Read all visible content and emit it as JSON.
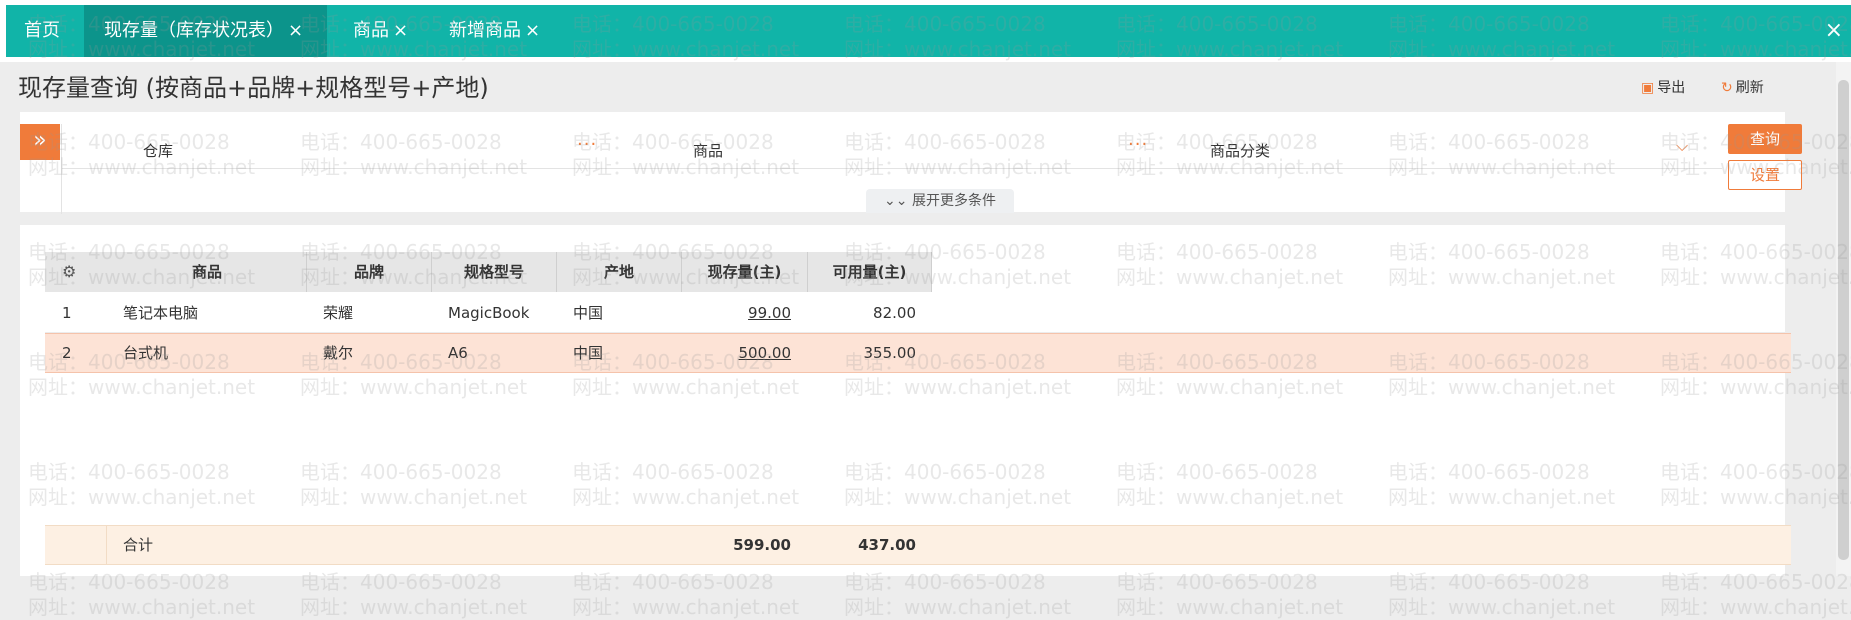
{
  "tabs": {
    "home": "首页",
    "items": [
      {
        "label": "现存量（库存状况表）",
        "close": "×"
      },
      {
        "label": "商品",
        "close": "×"
      },
      {
        "label": "新增商品",
        "close": "×"
      }
    ],
    "global_close": "×"
  },
  "page": {
    "title": "现存量查询 (按商品+品牌+规格型号+产地)",
    "export_label": "导出",
    "refresh_label": "刷新"
  },
  "filter": {
    "collapse_icon": "»",
    "warehouse_label": "仓库",
    "product_label": "商品",
    "category_label": "商品分类",
    "more_dots": "···",
    "chevron": "⌵",
    "query_button": "查询",
    "settings_button": "设置",
    "expand_more": "展开更多条件",
    "expand_icon": "≫"
  },
  "table": {
    "headers": [
      "商品",
      "品牌",
      "规格型号",
      "产地",
      "现存量(主)",
      "可用量(主)"
    ],
    "settings_icon": "gear-icon",
    "rows": [
      {
        "no": "1",
        "product": "笔记本电脑",
        "brand": "荣耀",
        "spec": "MagicBook",
        "origin": "中国",
        "on_hand": "99.00",
        "available": "82.00"
      },
      {
        "no": "2",
        "product": "台式机",
        "brand": "戴尔",
        "spec": "A6",
        "origin": "中国",
        "on_hand": "500.00",
        "available": "355.00"
      }
    ],
    "total": {
      "label": "合计",
      "on_hand": "599.00",
      "available": "437.00"
    }
  },
  "watermark": {
    "phone": "电话：400-665-0028",
    "site": "网址：www.chanjet.net"
  },
  "colors": {
    "teal": "#11b4a8",
    "teal_active": "#0c948b",
    "orange": "#f07b3a",
    "selected_row": "#fde3d6",
    "total_row": "#fdf0e3"
  }
}
